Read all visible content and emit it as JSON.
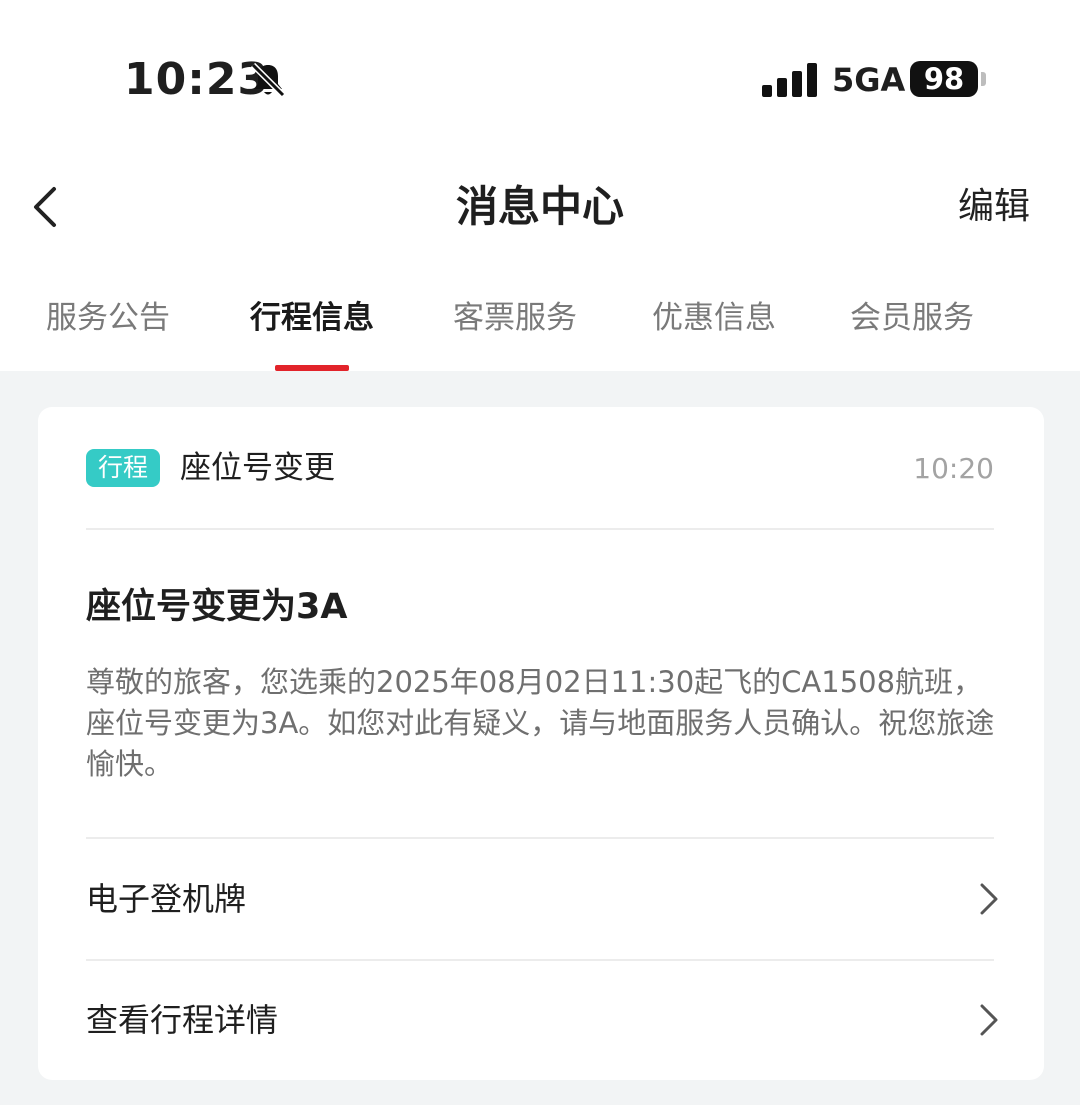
{
  "status_bar": {
    "time": "10:23",
    "network": "5GA",
    "battery": "98"
  },
  "header": {
    "title": "消息中心",
    "edit_label": "编辑"
  },
  "tabs": [
    {
      "label": "服务公告",
      "active": false
    },
    {
      "label": "行程信息",
      "active": true
    },
    {
      "label": "客票服务",
      "active": false
    },
    {
      "label": "优惠信息",
      "active": false
    },
    {
      "label": "会员服务",
      "active": false
    }
  ],
  "message": {
    "tag": "行程",
    "type": "座位号变更",
    "time": "10:20",
    "title": "座位号变更为3A",
    "body": "尊敬的旅客，您选乘的2025年08月02日11:30起飞的CA1508航班，座位号变更为3A。如您对此有疑义，请与地面服务人员确认。祝您旅途愉快。",
    "links": [
      {
        "label": "电子登机牌"
      },
      {
        "label": "查看行程详情"
      }
    ]
  },
  "colors": {
    "accent_red": "#e2232a",
    "tag_teal": "#35cbc6",
    "background": "#f2f4f5"
  }
}
